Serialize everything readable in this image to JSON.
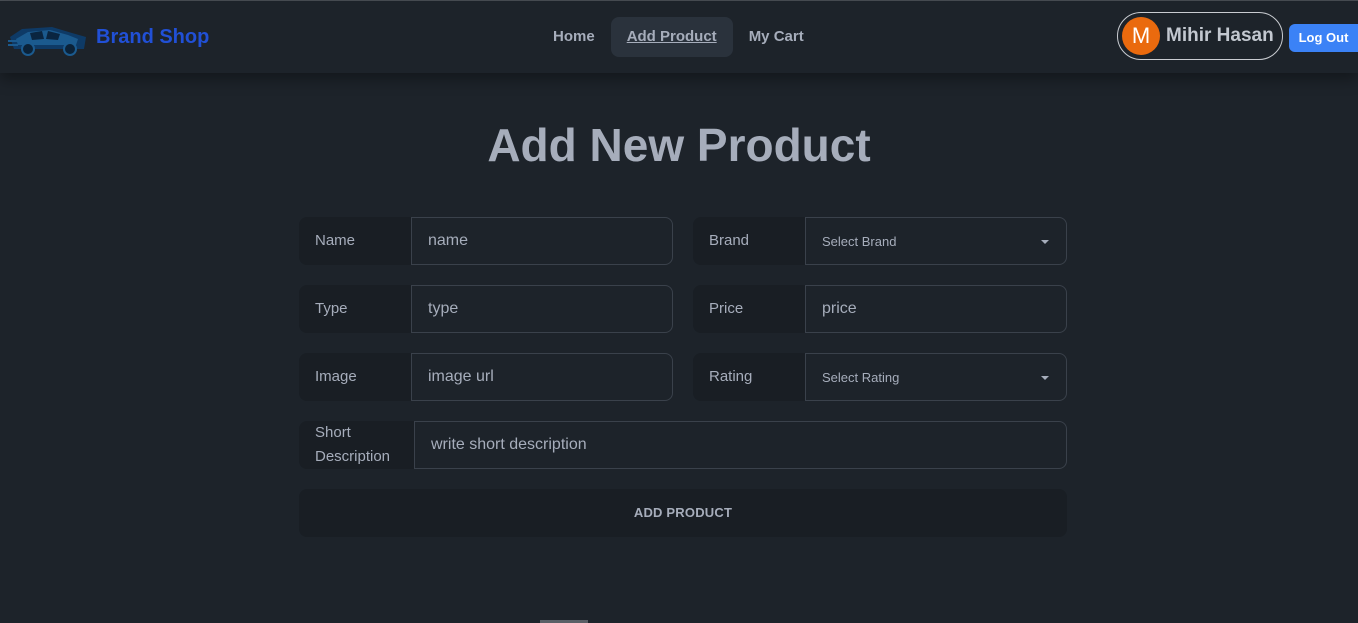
{
  "nav": {
    "brand_name": "Brand Shop",
    "menu": [
      {
        "label": "Home",
        "active": false
      },
      {
        "label": "Add Product",
        "active": true
      },
      {
        "label": "My Cart",
        "active": false
      }
    ],
    "user": {
      "initial": "M",
      "name": "Mihir Hasan"
    },
    "logout_label": "Log Out"
  },
  "page_title": "Add New Product",
  "form": {
    "name": {
      "label": "Name",
      "placeholder": "name"
    },
    "brand": {
      "label": "Brand",
      "selected": "Select Brand"
    },
    "type": {
      "label": "Type",
      "placeholder": "type"
    },
    "price": {
      "label": "Price",
      "placeholder": "price"
    },
    "image": {
      "label": "Image",
      "placeholder": "image url"
    },
    "rating": {
      "label": "Rating",
      "selected": "Select Rating"
    },
    "short_description": {
      "label": "Short Description",
      "placeholder": "write short description"
    },
    "submit_label": "ADD PRODUCT"
  },
  "colors": {
    "background": "#1d232a",
    "brand": "#2150d6",
    "avatar": "#ea6a0e",
    "logout": "#3b82f6"
  },
  "icons": [
    "car-logo-icon",
    "chevron-down-icon"
  ]
}
